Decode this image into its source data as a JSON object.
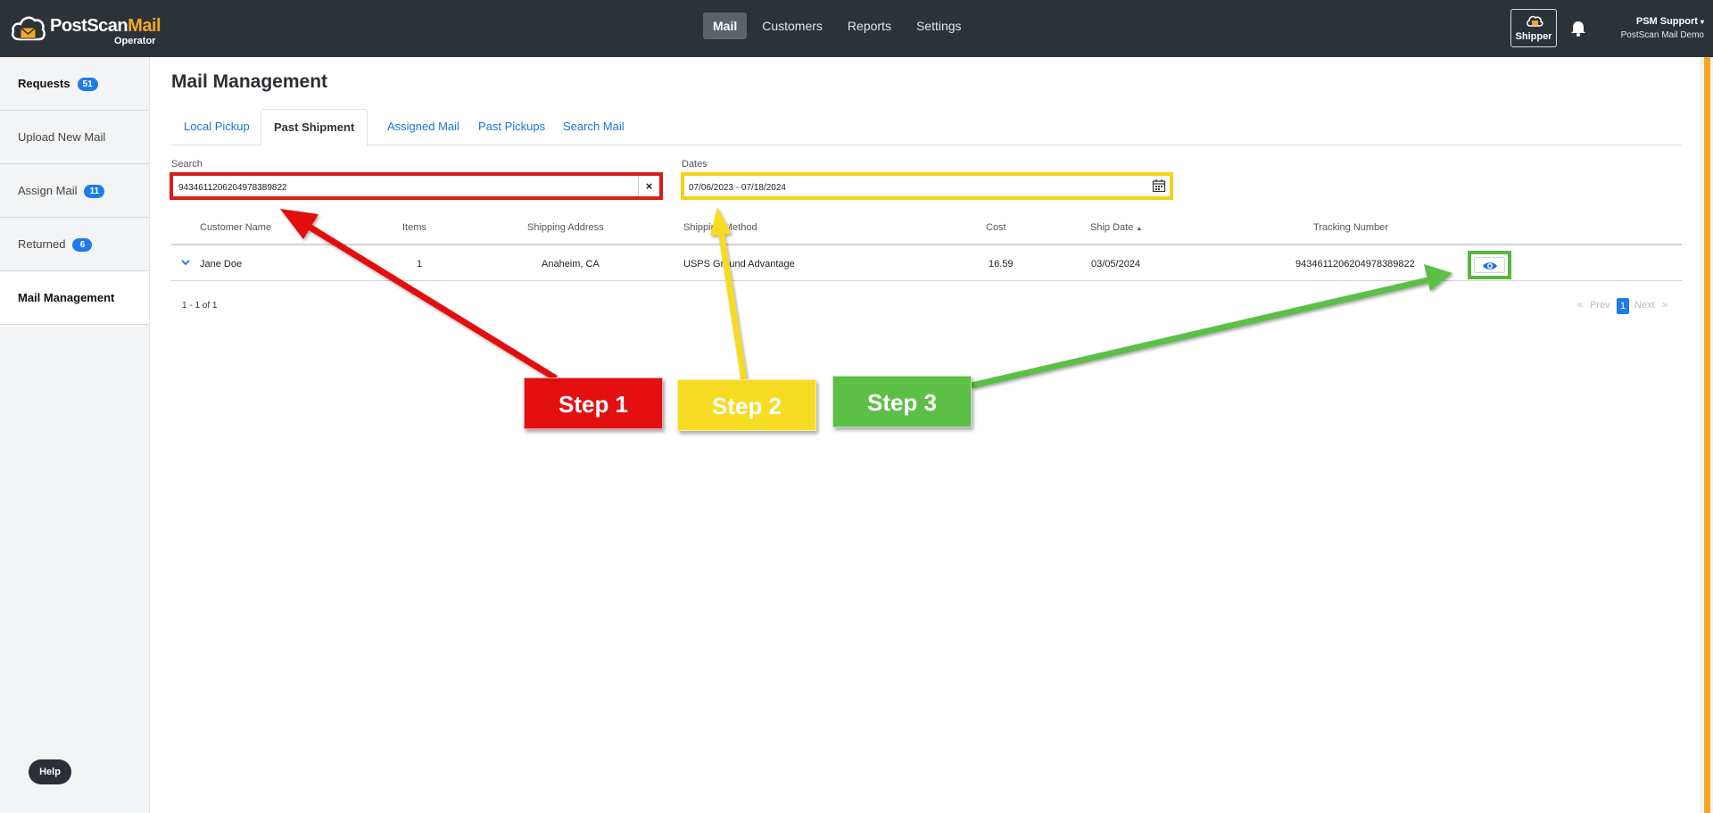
{
  "app": {
    "brand_part1": "PostScan",
    "brand_part2": "Mail",
    "subtitle": "Operator"
  },
  "nav": {
    "links": [
      "Mail",
      "Customers",
      "Reports",
      "Settings"
    ],
    "active": "Mail",
    "shipper_label": "Shipper",
    "user_name": "PSM Support",
    "user_org": "PostScan Mail Demo"
  },
  "sidebar": {
    "items": [
      {
        "label": "Requests",
        "badge": "51"
      },
      {
        "label": "Upload New Mail",
        "badge": ""
      },
      {
        "label": "Assign Mail",
        "badge": "11"
      },
      {
        "label": "Returned",
        "badge": "6"
      },
      {
        "label": "Mail Management",
        "badge": ""
      }
    ],
    "help_label": "Help"
  },
  "main": {
    "title": "Mail Management",
    "tabs": [
      "Local Pickup",
      "Past Shipment",
      "Assigned Mail",
      "Past Pickups",
      "Search Mail"
    ],
    "active_tab": "Past Shipment",
    "search_label": "Search",
    "search_value": "9434611206204978389822",
    "search_clear": "×",
    "dates_label": "Dates",
    "dates_value": "07/06/2023 - 07/18/2024"
  },
  "table": {
    "headers": [
      "Customer Name",
      "Items",
      "Shipping Address",
      "Shipping Method",
      "Cost",
      "Ship Date",
      "Tracking Number"
    ],
    "sort_indicator": "▲",
    "rows": [
      {
        "customer": "Jane Doe",
        "items": "1",
        "address": "Anaheim, CA",
        "method": "USPS Ground Advantage",
        "cost": "16.59",
        "ship_date": "03/05/2024",
        "tracking": "9434611206204978389822"
      }
    ],
    "range_text": "1 - 1 of 1",
    "pager": {
      "first": "«",
      "prev": "Prev",
      "current": "1",
      "next": "Next",
      "last": "»"
    }
  },
  "annotations": {
    "step1": "Step 1",
    "step2": "Step 2",
    "step3": "Step 3",
    "colors": {
      "step1": "#e30f10",
      "step2": "#f5dc22",
      "step3": "#5cbf46"
    }
  },
  "colors": {
    "navbar": "#2c3338",
    "accent_orange": "#f5a623",
    "link_blue": "#1a73d8",
    "badge_blue": "#1e7be8"
  }
}
